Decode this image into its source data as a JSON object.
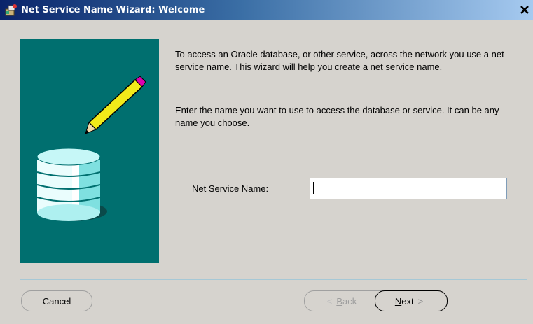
{
  "window": {
    "title": "Net Service Name Wizard: Welcome"
  },
  "content": {
    "paragraph1": "To access an Oracle database, or other service, across the network you use a net service name.  This wizard will help you create a net service name.",
    "paragraph2": "Enter the name you want to use to access the database or service.  It can be any name you choose."
  },
  "form": {
    "net_service_name_label": "Net Service Name:",
    "net_service_name_value": ""
  },
  "buttons": {
    "cancel": "Cancel",
    "back_first": "B",
    "back_rest": "ack",
    "next_first": "N",
    "next_rest": "ext"
  },
  "colors": {
    "title_start": "#0a246a",
    "title_end": "#a6caf0",
    "illustration_bg": "#006f6f",
    "window_bg": "#d6d3ce"
  },
  "icons": [
    "wizard-icon",
    "close-icon",
    "pencil-icon",
    "database-icon",
    "chevron-left-icon",
    "chevron-right-icon"
  ]
}
